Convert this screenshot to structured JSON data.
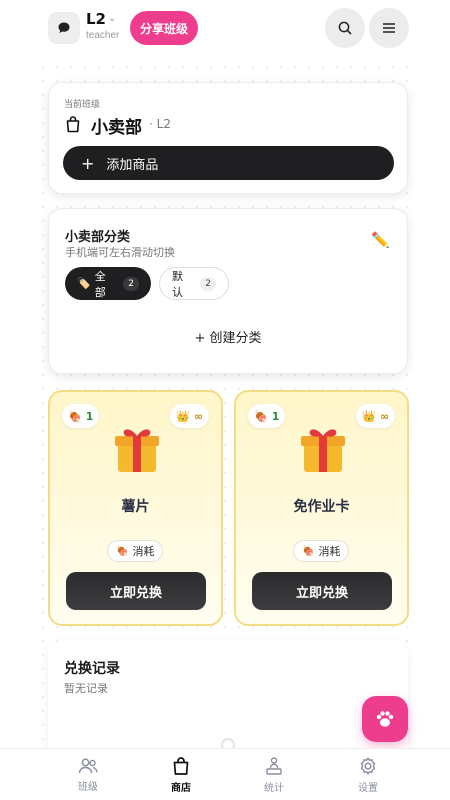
{
  "header": {
    "class_name": "L2",
    "role": "teacher",
    "share_label": "分享班级",
    "icons": {
      "chat": "chat-bubble-icon",
      "search": "search-icon",
      "menu": "hamburger-menu-icon",
      "caret": "chevron-down-icon"
    }
  },
  "current_class": {
    "label": "当前班级",
    "title": "小卖部",
    "sub": "· L2",
    "add_label": "添加商品"
  },
  "categories": {
    "title": "小卖部分类",
    "hint": "手机端可左右滑动切换",
    "chips": [
      {
        "label": "全部",
        "count": "2",
        "icon": "🏷️"
      },
      {
        "label": "默认",
        "count": "2"
      }
    ],
    "create_label": "+ 创建分类"
  },
  "products": [
    {
      "name": "薯片",
      "cost": "1",
      "stock": "∞",
      "tag": "消耗",
      "button": "立即兑换"
    },
    {
      "name": "免作业卡",
      "cost": "1",
      "stock": "∞",
      "tag": "消耗",
      "button": "立即兑换"
    }
  ],
  "records": {
    "title": "兑换记录",
    "empty": "暂无记录"
  },
  "tabs": [
    {
      "label": "班级",
      "icon": "people-icon"
    },
    {
      "label": "商店",
      "icon": "shopping-bag-icon"
    },
    {
      "label": "统计",
      "icon": "podium-icon"
    },
    {
      "label": "设置",
      "icon": "gear-icon"
    }
  ],
  "active_tab": "商店",
  "colors": {
    "accent": "#ef3d8e",
    "dark": "#1f1f21",
    "card_gold": "#f3dc86"
  }
}
